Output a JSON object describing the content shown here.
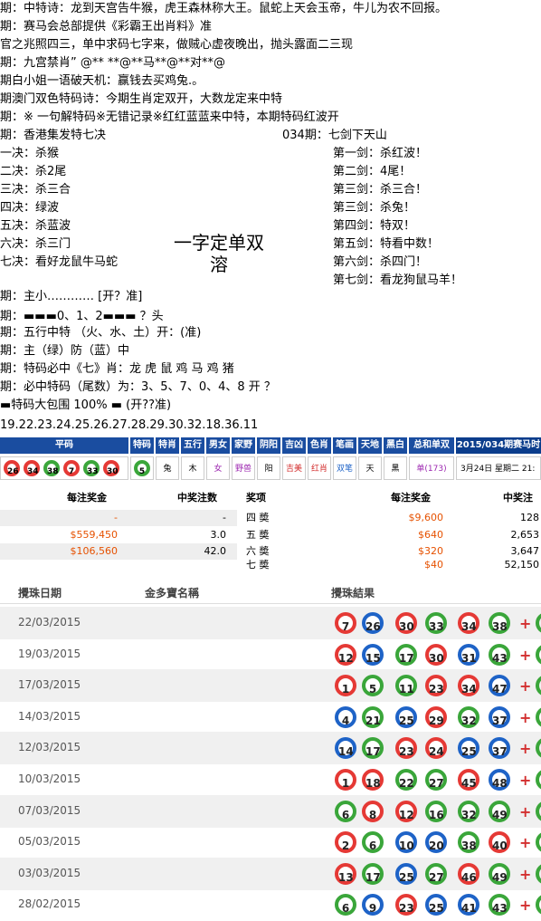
{
  "lines": [
    "期：中特诗：龙到天宫告牛猴，虎王森林称大王。鼠蛇上天会玉帝，牛儿为农不回报。",
    "期：赛马会总部提供《彩霸王出肖料》准",
    "官之兆照四三，单中求码七字来，做贼心虚夜晚出，抛头露面二三现",
    "期：九宫禁肖” @** **@**马**@**对**@",
    "期白小姐一语破天机：赢钱去买鸡兔.。",
    "期澳门双色特码诗：今期生肖定双开，大数龙定来中特",
    "期：※ 一句解特码※无错记录※红红蓝蓝来中特，本期特码红波开",
    "期：香港集发特七决"
  ],
  "period_label": "034期：七剑下天山",
  "jue": [
    "一决：杀猴",
    "二决：杀2尾",
    "三决：杀三合",
    "四决：绿波",
    "五决：杀蓝波",
    "六决：杀三门",
    "七决：看好龙鼠牛马蛇"
  ],
  "jian": [
    "第一剑：杀红波！",
    "第二剑：4尾！",
    "第三剑：杀三合！",
    "第三剑：杀兔！",
    "第四剑：特双！",
    "第五剑：特看中数！",
    "第六剑：杀四门！",
    "第七剑：看龙狗鼠马羊！"
  ],
  "big_text": [
    "一字定单双",
    "溶"
  ],
  "lines2": [
    "期：主小………… [开？准]",
    "期：▬▬▬0、1、2▬▬▬ ？头",
    "期：五行中特 （火、水、土）开：(准)",
    "期：主（绿）防（蓝）中",
    "期：特码必中《七》肖：龙 虎 鼠 鸡 马 鸡 猪",
    "期：必中特码（尾数）为：3、5、7、0、4、8 开 ？",
    "▬特码大包围 100% ▬ (开??准)",
    "19.22.23.24.25.26.27.28.29.30.32.18.36.11"
  ],
  "strip": {
    "headers": [
      "平码",
      "特码",
      "特肖",
      "五行",
      "男女",
      "家野",
      "阴阳",
      "吉凶",
      "色肖",
      "笔画",
      "天地",
      "黑白",
      "总和单双",
      "2015/034期赛马时间"
    ],
    "balls": [
      "26",
      "34",
      "38",
      "7",
      "33",
      "30"
    ],
    "special": "5",
    "cells": [
      "兔",
      "木",
      "女",
      "野兽",
      "阳",
      "吉美",
      "红肖",
      "双笔",
      "天",
      "黑",
      "单(173)",
      "3月24日 星期二 21:"
    ]
  },
  "prize": {
    "left_headers": [
      "每注奖金",
      "中奖注数"
    ],
    "left_rows": [
      {
        "amount": "-",
        "count": "-"
      },
      {
        "amount": "$559,450",
        "count": "3.0"
      },
      {
        "amount": "$106,560",
        "count": "42.0"
      }
    ],
    "right_headers": [
      "奖项",
      "每注奖金",
      "中奖注"
    ],
    "right_rows": [
      {
        "name": "四 奬",
        "amount": "$9,600",
        "count": "128"
      },
      {
        "name": "五 奬",
        "amount": "$640",
        "count": "2,653"
      },
      {
        "name": "六 奬",
        "amount": "$320",
        "count": "3,647"
      },
      {
        "name": "七 奬",
        "amount": "$40",
        "count": "52,150"
      }
    ]
  },
  "history": {
    "headers": [
      "攪珠日期",
      "金多寶名稱",
      "攪珠結果"
    ],
    "rows": [
      {
        "date": "22/03/2015",
        "balls": [
          "7",
          "26",
          "30",
          "33",
          "34",
          "38"
        ],
        "colors": [
          "red",
          "blue",
          "red",
          "green",
          "red",
          "green"
        ]
      },
      {
        "date": "19/03/2015",
        "balls": [
          "12",
          "15",
          "17",
          "30",
          "31",
          "43"
        ],
        "colors": [
          "red",
          "blue",
          "green",
          "red",
          "blue",
          "green"
        ]
      },
      {
        "date": "17/03/2015",
        "balls": [
          "1",
          "5",
          "11",
          "23",
          "34",
          "47"
        ],
        "colors": [
          "red",
          "green",
          "green",
          "red",
          "red",
          "blue"
        ]
      },
      {
        "date": "14/03/2015",
        "balls": [
          "4",
          "21",
          "25",
          "29",
          "32",
          "37"
        ],
        "colors": [
          "blue",
          "green",
          "blue",
          "red",
          "green",
          "blue"
        ]
      },
      {
        "date": "12/03/2015",
        "balls": [
          "14",
          "17",
          "23",
          "24",
          "25",
          "37"
        ],
        "colors": [
          "blue",
          "green",
          "red",
          "red",
          "blue",
          "blue"
        ]
      },
      {
        "date": "10/03/2015",
        "balls": [
          "1",
          "18",
          "22",
          "27",
          "45",
          "48"
        ],
        "colors": [
          "red",
          "red",
          "green",
          "green",
          "red",
          "blue"
        ]
      },
      {
        "date": "07/03/2015",
        "balls": [
          "6",
          "8",
          "12",
          "16",
          "32",
          "49"
        ],
        "colors": [
          "green",
          "red",
          "red",
          "green",
          "green",
          "green"
        ]
      },
      {
        "date": "05/03/2015",
        "balls": [
          "2",
          "6",
          "10",
          "20",
          "38",
          "40"
        ],
        "colors": [
          "red",
          "green",
          "blue",
          "blue",
          "green",
          "red"
        ]
      },
      {
        "date": "03/03/2015",
        "balls": [
          "13",
          "17",
          "25",
          "27",
          "46",
          "49"
        ],
        "colors": [
          "red",
          "green",
          "blue",
          "green",
          "red",
          "green"
        ]
      },
      {
        "date": "28/02/2015",
        "balls": [
          "6",
          "9",
          "23",
          "25",
          "41",
          "43"
        ],
        "colors": [
          "green",
          "blue",
          "red",
          "blue",
          "blue",
          "green"
        ]
      }
    ]
  },
  "colors": {
    "strip_header": "#1a4da0",
    "red": "#e53935",
    "blue": "#1e63c7",
    "green": "#3aa63a",
    "amount": "#e65100"
  }
}
